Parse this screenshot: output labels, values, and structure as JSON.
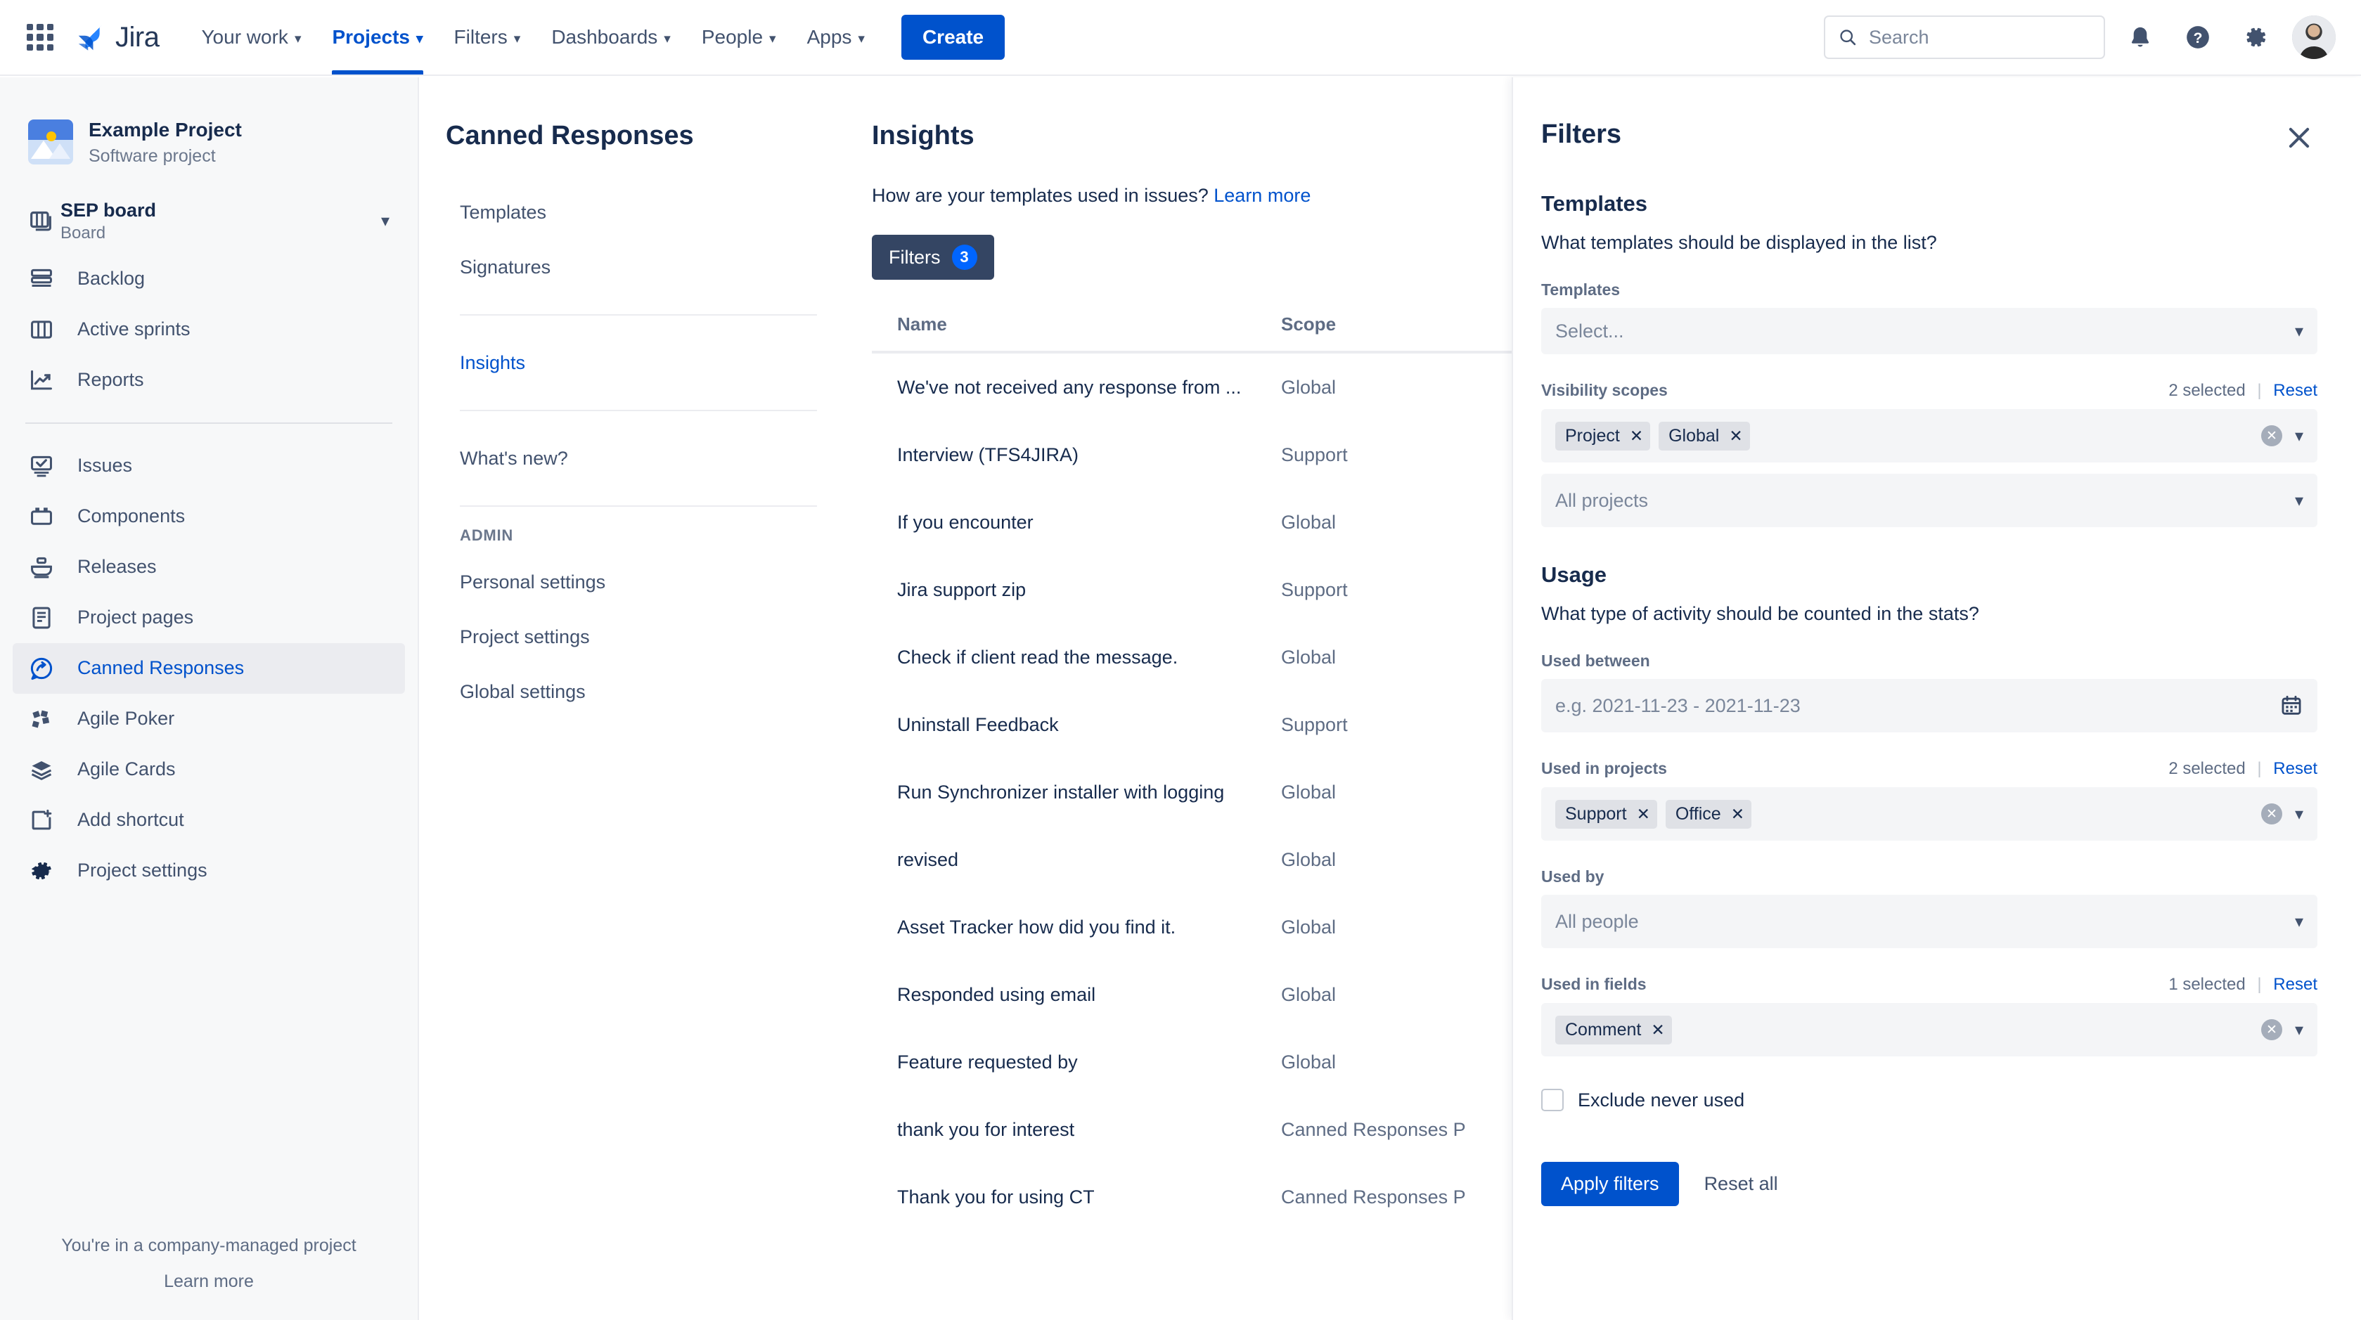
{
  "topnav": {
    "app_switcher": "app-switcher",
    "product_name": "Jira",
    "items": [
      {
        "label": "Your work",
        "has_caret": true,
        "active": false
      },
      {
        "label": "Projects",
        "has_caret": true,
        "active": true
      },
      {
        "label": "Filters",
        "has_caret": true,
        "active": false
      },
      {
        "label": "Dashboards",
        "has_caret": true,
        "active": false
      },
      {
        "label": "People",
        "has_caret": true,
        "active": false
      },
      {
        "label": "Apps",
        "has_caret": true,
        "active": false
      }
    ],
    "create_label": "Create",
    "search_placeholder": "Search",
    "accent_color": "#0052cc"
  },
  "sidebar": {
    "project_name": "Example Project",
    "project_type": "Software project",
    "board": {
      "name": "SEP board",
      "subtitle": "Board"
    },
    "items": [
      {
        "label": "Backlog",
        "icon": "backlog-icon"
      },
      {
        "label": "Active sprints",
        "icon": "board-columns-icon"
      },
      {
        "label": "Reports",
        "icon": "reports-icon"
      }
    ],
    "items2": [
      {
        "label": "Issues",
        "icon": "issues-icon"
      },
      {
        "label": "Components",
        "icon": "components-icon"
      },
      {
        "label": "Releases",
        "icon": "releases-icon"
      },
      {
        "label": "Project pages",
        "icon": "pages-icon"
      },
      {
        "label": "Canned Responses",
        "icon": "canned-responses-icon",
        "selected": true
      },
      {
        "label": "Agile Poker",
        "icon": "agile-poker-icon"
      },
      {
        "label": "Agile Cards",
        "icon": "agile-cards-icon"
      },
      {
        "label": "Add shortcut",
        "icon": "add-shortcut-icon"
      },
      {
        "label": "Project settings",
        "icon": "gear-icon"
      }
    ],
    "footer_note": "You're in a company-managed project",
    "footer_link": "Learn more"
  },
  "secnav": {
    "title": "Canned Responses",
    "group1": [
      {
        "label": "Templates"
      },
      {
        "label": "Signatures"
      }
    ],
    "group2": [
      {
        "label": "Insights",
        "selected": true
      }
    ],
    "group3": [
      {
        "label": "What's new?"
      }
    ],
    "admin_label": "ADMIN",
    "group4": [
      {
        "label": "Personal settings"
      },
      {
        "label": "Project settings"
      },
      {
        "label": "Global settings"
      }
    ]
  },
  "main": {
    "title": "Insights",
    "subtitle_text": "How are your templates used in issues?",
    "subtitle_link": "Learn more",
    "filters_button_label": "Filters",
    "filters_count": "3",
    "table": {
      "columns": [
        "Name",
        "Scope"
      ],
      "rows": [
        {
          "name": "We've not received any response from ...",
          "scope": "Global"
        },
        {
          "name": "Interview (TFS4JIRA)",
          "scope": "Support"
        },
        {
          "name": "If you encounter",
          "scope": "Global"
        },
        {
          "name": "Jira support zip",
          "scope": "Support"
        },
        {
          "name": "Check if client read the message.",
          "scope": "Global"
        },
        {
          "name": "Uninstall Feedback",
          "scope": "Support"
        },
        {
          "name": "Run Synchronizer installer with logging",
          "scope": "Global"
        },
        {
          "name": "revised",
          "scope": "Global"
        },
        {
          "name": "Asset Tracker how did you find it.",
          "scope": "Global"
        },
        {
          "name": "Responded using email",
          "scope": "Global"
        },
        {
          "name": "Feature requested by",
          "scope": "Global"
        },
        {
          "name": "thank you for interest",
          "scope": "Canned Responses P"
        },
        {
          "name": "Thank you for using CT",
          "scope": "Canned Responses P"
        }
      ]
    }
  },
  "panel": {
    "title": "Filters",
    "close_icon": "close-icon",
    "templates_section": {
      "heading": "Templates",
      "question": "What templates should be displayed in the list?",
      "templates_field": {
        "label": "Templates",
        "placeholder": "Select..."
      },
      "visibility_field": {
        "label": "Visibility scopes",
        "meta_count": "2 selected",
        "meta_reset": "Reset",
        "chips": [
          "Project",
          "Global"
        ]
      },
      "projects_field": {
        "placeholder": "All projects"
      }
    },
    "usage_section": {
      "heading": "Usage",
      "question": "What type of activity should be counted in the stats?",
      "used_between": {
        "label": "Used between",
        "placeholder": "e.g. 2021-11-23  -  2021-11-23",
        "icon": "calendar-icon"
      },
      "used_in_projects": {
        "label": "Used in projects",
        "meta_count": "2 selected",
        "meta_reset": "Reset",
        "chips": [
          "Support",
          "Office"
        ]
      },
      "used_by": {
        "label": "Used by",
        "placeholder": "All people"
      },
      "used_in_fields": {
        "label": "Used in fields",
        "meta_count": "1 selected",
        "meta_reset": "Reset",
        "chips": [
          "Comment"
        ]
      },
      "exclude_never_used": {
        "label": "Exclude never used",
        "checked": false
      }
    },
    "apply_label": "Apply filters",
    "reset_all_label": "Reset all"
  }
}
